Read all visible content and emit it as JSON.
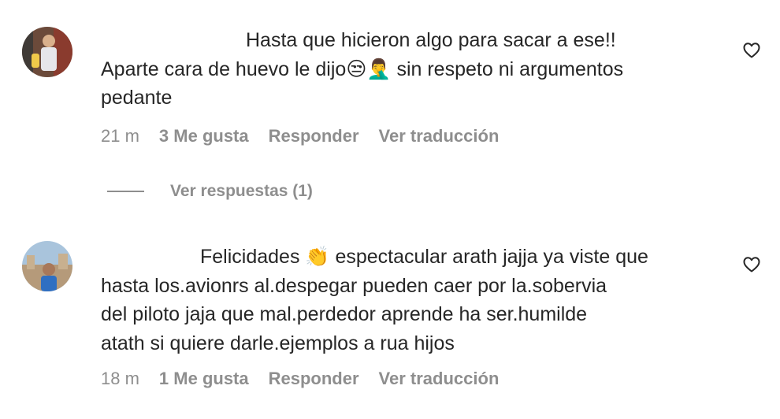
{
  "comments": [
    {
      "lines": [
        "Hasta que hicieron algo para sacar a ese!!",
        "Aparte cara de huevo le dijo😒🤦‍♂️ sin respeto ni argumentos",
        "pedante"
      ],
      "time": "21 m",
      "likes": "3 Me gusta",
      "reply": "Responder",
      "translate": "Ver traducción",
      "like_icon": "heart-outline",
      "avatar_icon": "user-avatar"
    },
    {
      "lines": [
        "Felicidades 👏 espectacular arath jajja ya viste que",
        "hasta los.avionrs al.despegar pueden caer por la.sobervia",
        "del piloto jaja que mal.perdedor aprende ha ser.humilde",
        "atath si quiere darle.ejemplos a rua hijos"
      ],
      "time": "18 m",
      "likes": "1 Me gusta",
      "reply": "Responder",
      "translate": "Ver traducción",
      "like_icon": "heart-outline",
      "avatar_icon": "user-avatar"
    }
  ],
  "replies_label": "Ver respuestas (1)",
  "colors": {
    "text": "#262626",
    "muted": "#8e8e8e",
    "background": "#ffffff"
  }
}
